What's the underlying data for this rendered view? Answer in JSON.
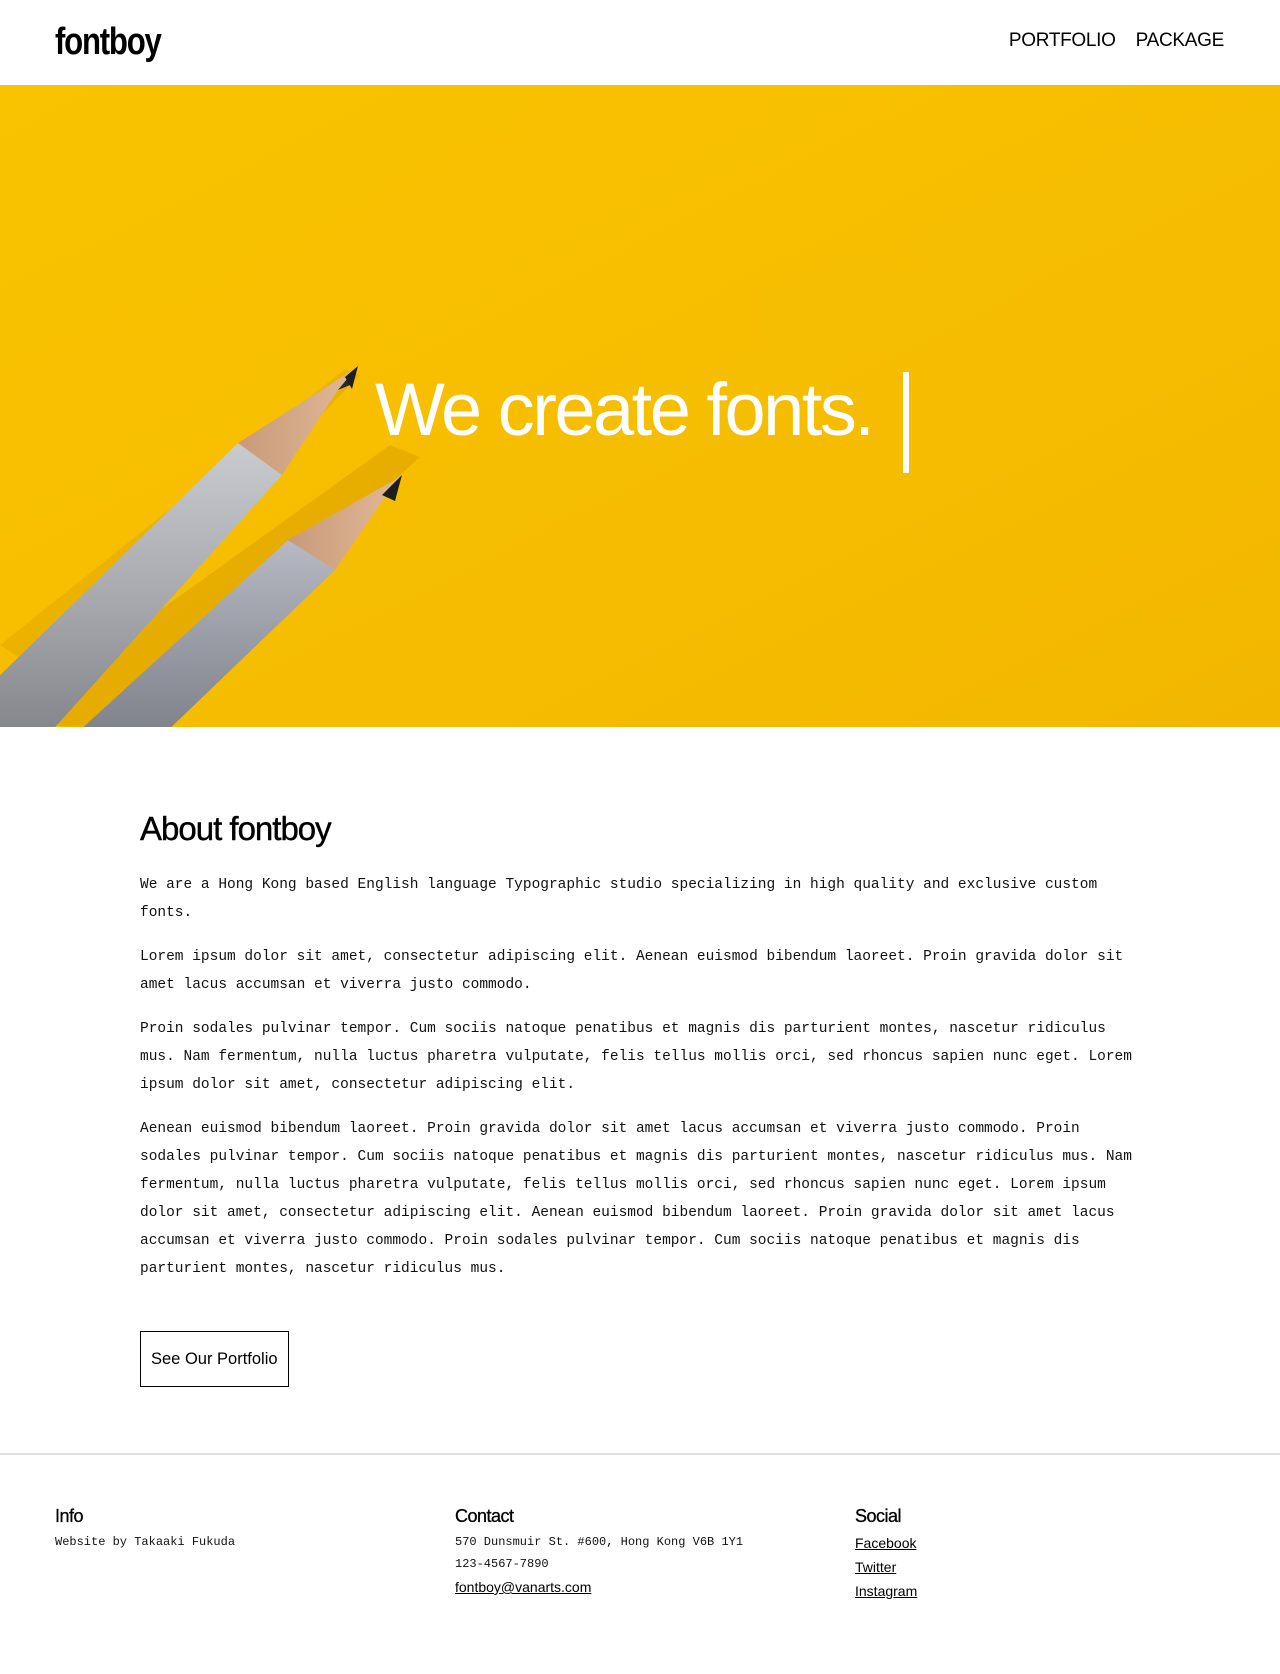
{
  "header": {
    "logo": "fontboy",
    "nav": [
      {
        "label": "PORTFOLIO"
      },
      {
        "label": "PACKAGE"
      }
    ]
  },
  "hero": {
    "headline": "We create fonts."
  },
  "about": {
    "title": "About fontboy",
    "paragraphs": [
      "We are a Hong Kong based English language Typographic studio specializing in high quality and exclusive custom fonts.",
      "Lorem ipsum dolor sit amet, consectetur adipiscing elit. Aenean euismod bibendum laoreet. Proin gravida dolor sit amet lacus accumsan et viverra justo commodo.",
      "Proin sodales pulvinar tempor. Cum sociis natoque penatibus et magnis dis parturient montes, nascetur ridiculus mus. Nam fermentum, nulla luctus pharetra vulputate, felis tellus mollis orci, sed rhoncus sapien nunc eget. Lorem ipsum dolor sit amet, consectetur adipiscing elit.",
      "Aenean euismod bibendum laoreet. Proin gravida dolor sit amet lacus accumsan et viverra justo commodo. Proin sodales pulvinar tempor. Cum sociis natoque penatibus et magnis dis parturient montes, nascetur ridiculus mus. Nam fermentum, nulla luctus pharetra vulputate, felis tellus mollis orci, sed rhoncus sapien nunc eget. Lorem ipsum dolor sit amet, consectetur adipiscing elit. Aenean euismod bibendum laoreet. Proin gravida dolor sit amet lacus accumsan et viverra justo commodo. Proin sodales pulvinar tempor. Cum sociis natoque penatibus et magnis dis parturient montes, nascetur ridiculus mus."
    ],
    "button_label": "See Our Portfolio"
  },
  "footer": {
    "info": {
      "title": "Info",
      "text": "Website by Takaaki Fukuda"
    },
    "contact": {
      "title": "Contact",
      "address": "570 Dunsmuir St. #600, Hong Kong V6B 1Y1",
      "phone": "123-4567-7890",
      "email": "fontboy@vanarts.com"
    },
    "social": {
      "title": "Social",
      "links": [
        {
          "label": "Facebook"
        },
        {
          "label": "Twitter"
        },
        {
          "label": "Instagram"
        }
      ]
    }
  },
  "colors": {
    "hero_yellow": "#f7bf00",
    "text": "#111111",
    "footer_rule": "#e0e0e0"
  }
}
